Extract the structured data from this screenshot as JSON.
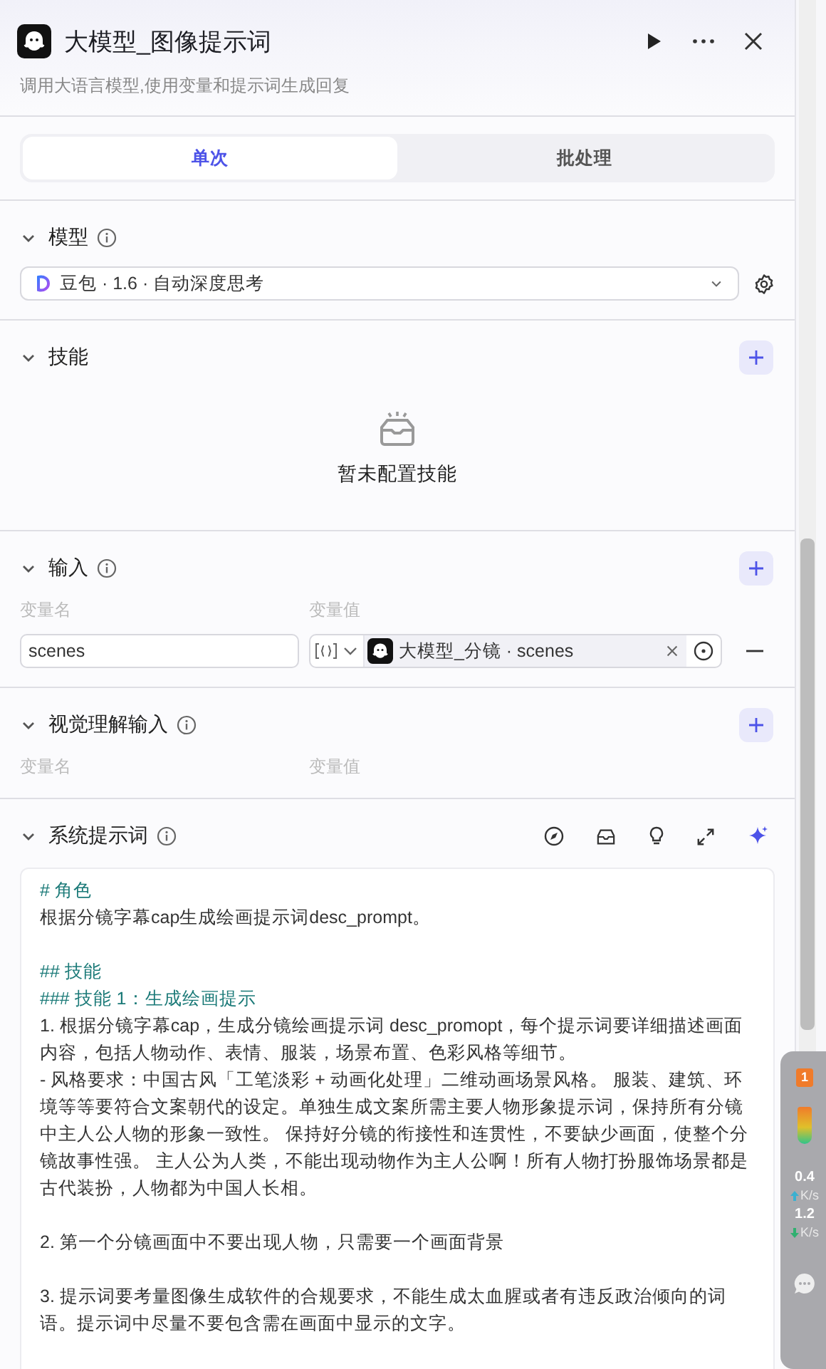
{
  "node": {
    "title": "大模型_图像提示词",
    "description": "调用大语言模型,使用变量和提示词生成回复"
  },
  "tabs": [
    {
      "label": "单次",
      "selected": true
    },
    {
      "label": "批处理",
      "selected": false
    }
  ],
  "sections": [
    {
      "kind": "model",
      "title": "模型",
      "info": true,
      "expanded": true,
      "model": "豆包 · 1.6 · 自动深度思考"
    },
    {
      "kind": "skills",
      "title": "技能",
      "info": false,
      "expanded": true,
      "empty_text": "暂未配置技能"
    },
    {
      "kind": "variables",
      "title": "输入",
      "info": true,
      "expanded": true,
      "columns": [
        "变量名",
        "变量值"
      ],
      "rows": [
        {
          "name": "scenes",
          "ref": "大模型_分镜 · scenes"
        }
      ]
    },
    {
      "kind": "variables",
      "title": "视觉理解输入",
      "info": true,
      "expanded": true,
      "columns": [
        "变量名",
        "变量值"
      ]
    },
    {
      "kind": "prompt",
      "title": "系统提示词",
      "info": true,
      "expanded": true,
      "lines": [
        {
          "kind": "heading",
          "text": "# 角色",
          "spaced": false
        },
        {
          "kind": "text",
          "text": "根据分镜字幕cap生成绘画提示词desc_prompt。",
          "spaced": false
        },
        {
          "kind": "heading",
          "text": "## 技能",
          "spaced": true
        },
        {
          "kind": "heading",
          "text": "### 技能 1：生成绘画提示",
          "spaced": false
        },
        {
          "kind": "text",
          "text": "1. 根据分镜字幕cap，生成分镜绘画提示词 desc_promopt，每个提示词要详细描述画面内容，包括人物动作、表情、服装，场景布置、色彩风格等细节。",
          "spaced": false
        },
        {
          "kind": "text",
          "text": " - 风格要求：中国古风「工笔淡彩 + 动画化处理」二维动画场景风格。 服装、建筑、环境等等要符合文案朝代的设定。单独生成文案所需主要人物形象提示词，保持所有分镜中主人公人物的形象一致性。 保持好分镜的衔接性和连贯性，不要缺少画面，使整个分镜故事性强。 主人公为人类，不能出现动物作为主人公啊！所有人物打扮服饰场景都是古代装扮，人物都为中国人长相。",
          "spaced": false
        },
        {
          "kind": "text",
          "text": "2.  第一个分镜画面中不要出现人物，只需要一个画面背景",
          "spaced": true
        },
        {
          "kind": "text",
          "text": "3. 提示词要考量图像生成软件的合规要求，不能生成太血腥或者有违反政治倾向的词语。提示词中尽量不要包含需在画面中显示的文字。",
          "spaced": true
        }
      ]
    }
  ],
  "monitor": {
    "badge": "1",
    "upload": "0.4",
    "upload_unit": "K/s",
    "download": "1.2",
    "download_unit": "K/s"
  }
}
